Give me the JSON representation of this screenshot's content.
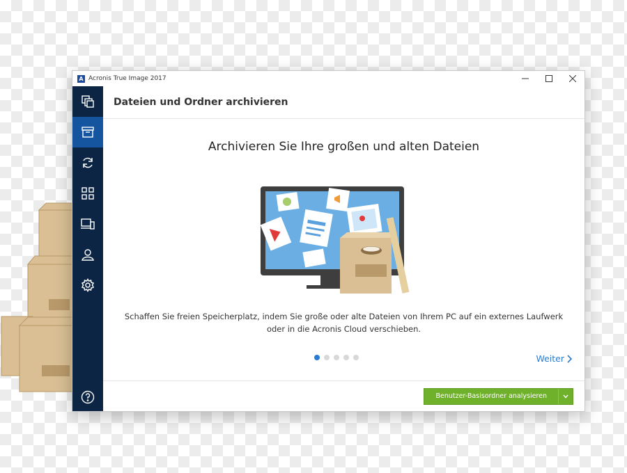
{
  "window": {
    "title": "Acronis True Image 2017",
    "logo_letter": "A",
    "controls": [
      "minimize-icon",
      "maximize-icon",
      "close-icon"
    ]
  },
  "sidebar": {
    "items": [
      {
        "icon": "backup-icon",
        "active": false
      },
      {
        "icon": "archive-icon",
        "active": true
      },
      {
        "icon": "sync-icon",
        "active": false
      },
      {
        "icon": "tools-grid-icon",
        "active": false
      },
      {
        "icon": "devices-icon",
        "active": false
      },
      {
        "icon": "account-icon",
        "active": false
      },
      {
        "icon": "settings-gear-icon",
        "active": false
      }
    ],
    "help_icon": "help-icon"
  },
  "page": {
    "header": "Dateien und Ordner archivieren",
    "headline": "Archivieren Sie Ihre großen und alten Dateien",
    "description_line1": "Schaffen Sie freien Speicherplatz, indem Sie große oder alte Dateien von Ihrem PC auf ein externes Laufwerk",
    "description_line2": "oder in die Acronis Cloud verschieben.",
    "pager": {
      "total": 5,
      "current": 1
    },
    "next_label": "Weiter",
    "action_button": "Benutzer-Basisordner analysieren"
  },
  "colors": {
    "sidebar_bg": "#0d2545",
    "sidebar_active": "#15549e",
    "accent_blue": "#2a7bd1",
    "button_green": "#6fb12b"
  }
}
